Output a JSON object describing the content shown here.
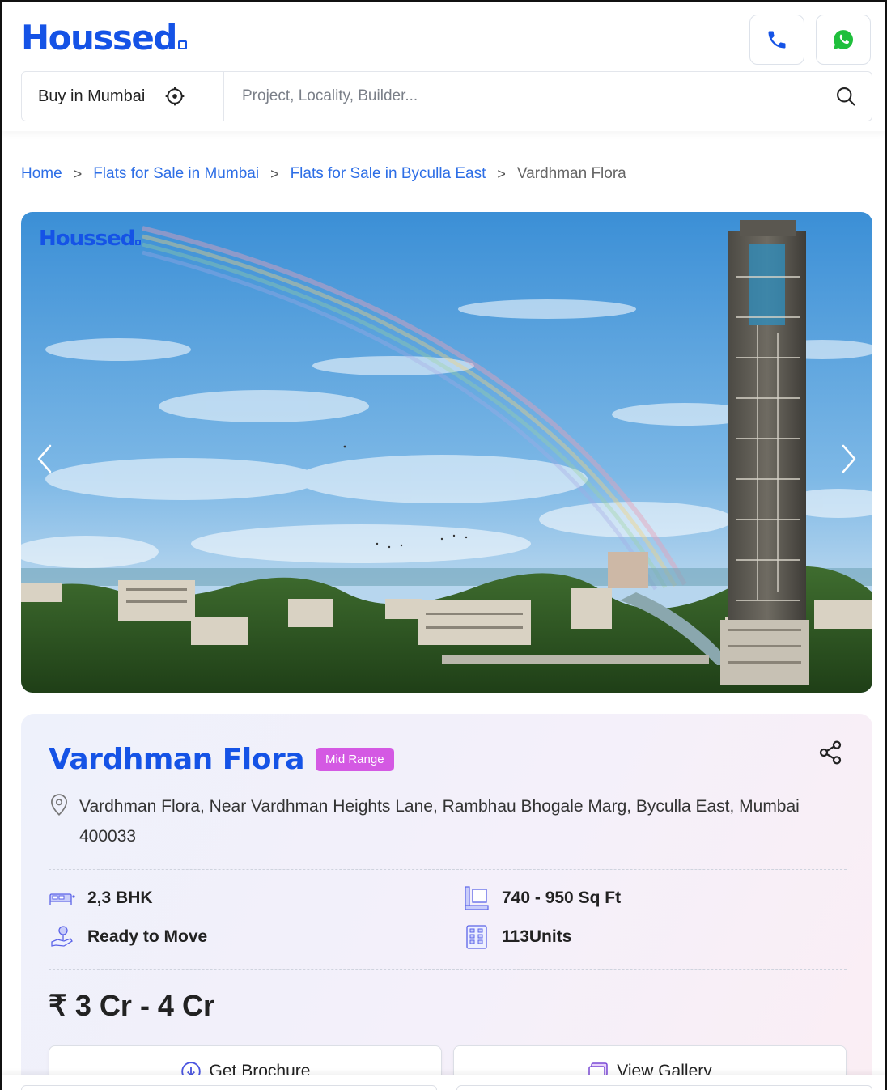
{
  "header": {
    "logo": "Houssed",
    "call_icon": "phone-icon",
    "whatsapp_icon": "whatsapp-icon"
  },
  "search": {
    "city_label": "Buy in Mumbai",
    "location_icon": "locate-icon",
    "placeholder": "Project, Locality, Builder...",
    "value": ""
  },
  "breadcrumb": {
    "items": [
      "Home",
      "Flats for Sale in Mumbai",
      "Flats for Sale in Byculla East"
    ],
    "current": "Vardhman Flora",
    "separator": ">"
  },
  "gallery": {
    "watermark": "Houssed",
    "prev_icon": "chevron-left-icon",
    "next_icon": "chevron-right-icon"
  },
  "project": {
    "name": "Vardhman Flora",
    "badge": "Mid Range",
    "address": "Vardhman Flora, Near Vardhman Heights Lane, Rambhau Bhogale Marg, Byculla East, Mumbai 400033",
    "specs": {
      "configuration": "2,3 BHK",
      "status": "Ready to Move",
      "area": "740 - 950 Sq Ft",
      "units": "113Units"
    },
    "price": "₹ 3 Cr - 4 Cr"
  },
  "actions": {
    "brochure": "Get Brochure",
    "gallery": "View Gallery"
  },
  "colors": {
    "brand_blue": "#1553e6",
    "link_blue": "#2d6ee6",
    "badge_magenta": "#d459e3",
    "whatsapp_green": "#1fbf3c"
  }
}
